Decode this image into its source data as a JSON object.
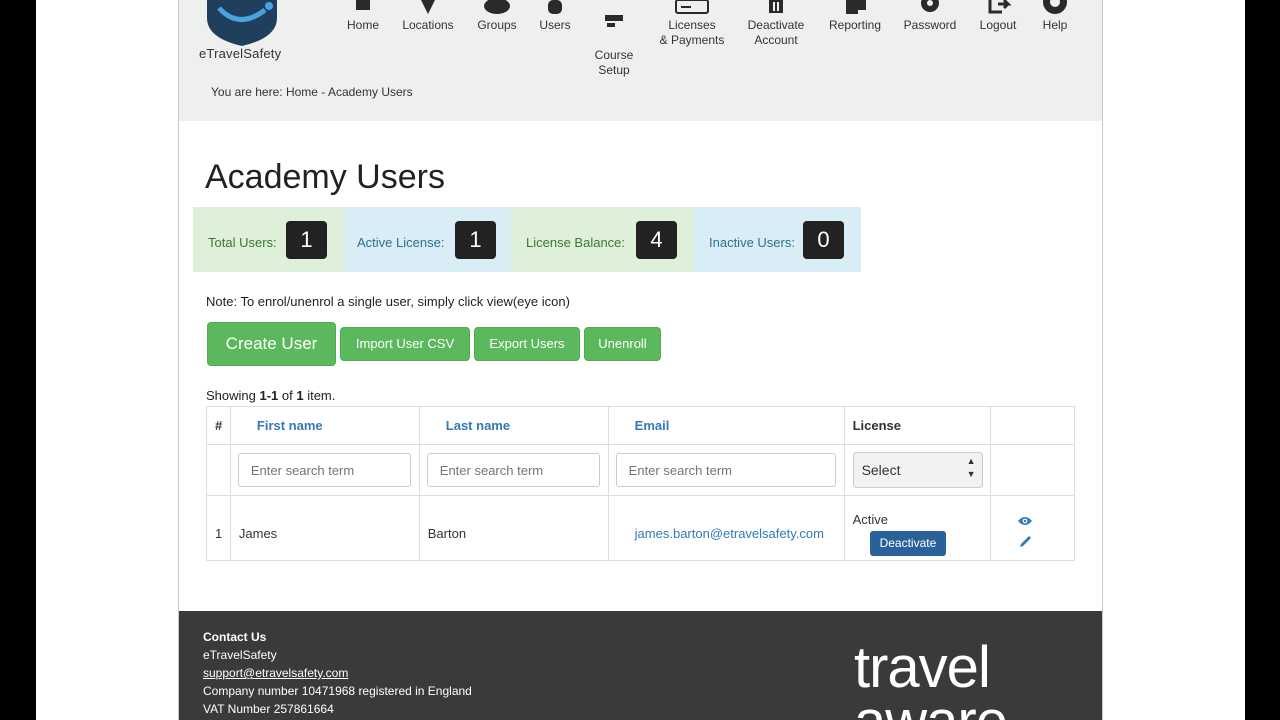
{
  "brand": {
    "name": "eTravelSafety"
  },
  "nav": [
    {
      "label": "Home",
      "icon": "home-icon"
    },
    {
      "label": "Locations",
      "icon": "map-pin-icon"
    },
    {
      "label": "Groups",
      "icon": "group-icon"
    },
    {
      "label": "Users",
      "icon": "user-icon"
    },
    {
      "label": "Course\nSetup",
      "icon": "course-icon"
    },
    {
      "label": "Licenses\n& Payments",
      "icon": "credit-card-icon"
    },
    {
      "label": "Deactivate\nAccount",
      "icon": "trash-icon"
    },
    {
      "label": "Reporting",
      "icon": "report-icon"
    },
    {
      "label": "Password",
      "icon": "gear-icon"
    },
    {
      "label": "Logout",
      "icon": "logout-icon"
    },
    {
      "label": "Help",
      "icon": "lifebuoy-icon"
    }
  ],
  "breadcrumb": "You are here: Home - Academy Users",
  "page_title": "Academy Users",
  "stats": [
    {
      "label": "Total Users:",
      "value": "1",
      "color": "#dff0d8"
    },
    {
      "label": "Active License:",
      "value": "1",
      "color": "#d9edf7"
    },
    {
      "label": "License Balance:",
      "value": "4",
      "color": "#dff0d8"
    },
    {
      "label": "Inactive Users:",
      "value": "0",
      "color": "#d9edf7"
    }
  ],
  "note": "Note: To enrol/unenrol a single user, simply click view(eye icon)",
  "actions": {
    "create": "Create User",
    "import": "Import User CSV",
    "export": "Export Users",
    "unenroll": "Unenroll"
  },
  "showing": {
    "prefix": "Showing ",
    "range": "1-1",
    "of": " of ",
    "total": "1",
    "suffix": " item."
  },
  "table": {
    "columns": [
      "#",
      "First name",
      "Last name",
      "Email",
      "License"
    ],
    "search_placeholder": "Enter search term",
    "license_filter": "Select",
    "rows": [
      {
        "num": "1",
        "first": "James",
        "last": "Barton",
        "email": "james.barton@etravelsafety.com",
        "license": "Active",
        "action": "Deactivate"
      }
    ]
  },
  "footer": {
    "heading": "Contact Us",
    "company": "eTravelSafety",
    "email": "support@etravelsafety.com",
    "company_number": "Company number 10471968 registered in England",
    "vat": "VAT Number 257861664",
    "partner_logo": "travel aware"
  },
  "colors": {
    "primary_green": "#5cb85c",
    "deactivate_blue": "#2b6199",
    "link_blue": "#337ab7",
    "footer_bg": "#3a3a3a"
  }
}
